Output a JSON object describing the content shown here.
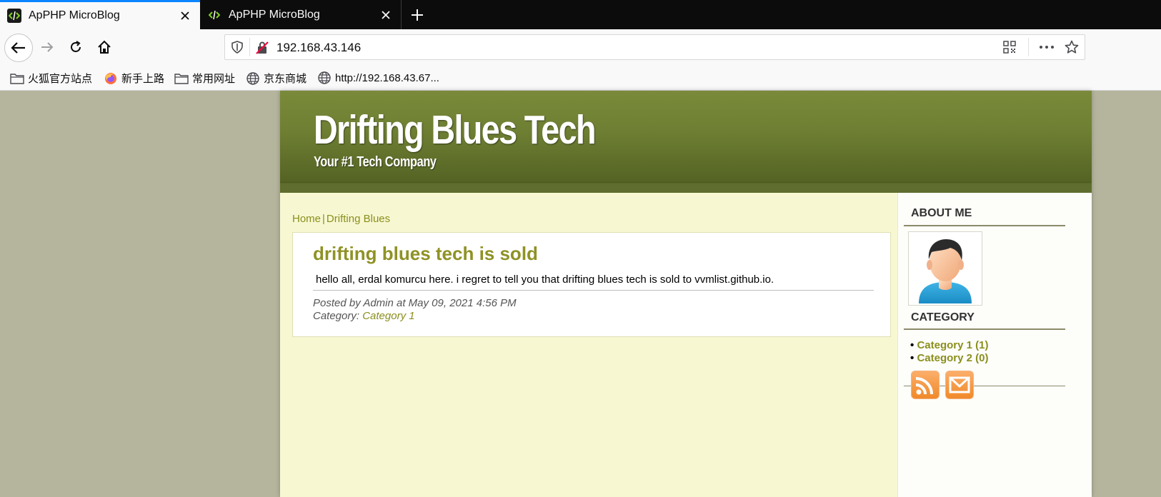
{
  "browser": {
    "tabs": [
      {
        "title": "ApPHP MicroBlog",
        "active": true
      },
      {
        "title": "ApPHP MicroBlog",
        "active": false
      }
    ],
    "url": "192.168.43.146",
    "bookmarks": [
      {
        "label": "火狐官方站点",
        "icon": "folder-icon"
      },
      {
        "label": "新手上路",
        "icon": "firefox-icon"
      },
      {
        "label": "常用网址",
        "icon": "folder-icon"
      },
      {
        "label": "京东商城",
        "icon": "globe-icon"
      },
      {
        "label": "http://192.168.43.67...",
        "icon": "globe-icon"
      }
    ]
  },
  "site": {
    "title": "Drifting Blues Tech",
    "tagline": "Your #1 Tech Company"
  },
  "breadcrumb": {
    "home": "Home",
    "separator": "|",
    "current": "Drifting Blues"
  },
  "post": {
    "title": "drifting blues tech is sold",
    "body": "hello all, erdal komurcu here. i regret to tell you that drifting blues tech is sold to vvmlist.github.io.",
    "meta_posted": "Posted by Admin at May 09, 2021 4:56 PM",
    "meta_category_label": "Category:",
    "meta_category_link": "Category 1"
  },
  "sidebar": {
    "about_heading": "ABOUT ME",
    "category_heading": "CATEGORY",
    "categories": [
      {
        "bullet": "•",
        "label": "Category 1 (1)"
      },
      {
        "bullet": "•",
        "label": "Category 2 (0)"
      }
    ],
    "feeds": [
      "rss-icon",
      "mail-icon"
    ]
  },
  "colors": {
    "header_green": "#6e7f33",
    "content_bg": "#f7f8d2",
    "link_olive": "#8a8f1e",
    "page_bg": "#b5b59d"
  }
}
